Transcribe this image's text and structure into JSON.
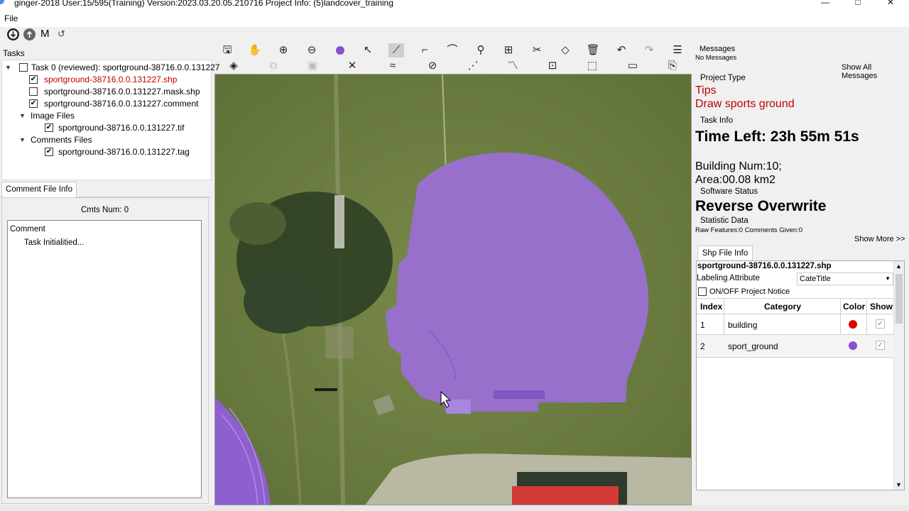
{
  "window": {
    "title": "ginger-2018    User:15/595(Training)    Version:2023.03.20.05.210716    Project Info: (5)landcover_training",
    "minimize": "—",
    "maximize": "□",
    "close": "✕"
  },
  "menu": {
    "file": "File"
  },
  "quick_toolbar": {
    "m_label": "M"
  },
  "tasks": {
    "label": "Tasks",
    "root": "Task 0 (reviewed): sportground-38716.0.0.131227",
    "shp": "sportground-38716.0.0.131227.shp",
    "mask": "sportground-38716.0.0.131227.mask.shp",
    "comment": "sportground-38716.0.0.131227.comment",
    "image_files_label": "Image Files",
    "tif": "sportground-38716.0.0.131227.tif",
    "comments_files_label": "Comments Files",
    "tag": "sportground-38716.0.0.131227.tag"
  },
  "comment_panel": {
    "tab": "Comment File Info",
    "cmts_num": "Cmts Num:  0",
    "comment_header": "Comment",
    "comment_text": "Task Initialitied..."
  },
  "messages": {
    "title": "Messages",
    "body": "No Messages",
    "show_all": "Show All Messages"
  },
  "project_type": {
    "label": "Project Type",
    "tips": "Tips",
    "instruction": "Draw sports ground"
  },
  "task_info": {
    "label": "Task Info",
    "time_left": "Time Left: 23h 55m 51s",
    "building_num": "Building Num:10;",
    "area": "Area:00.08 km2"
  },
  "software_status": {
    "label": "Software Status",
    "value": "Reverse Overwrite"
  },
  "statistic": {
    "label": "Statistic Data",
    "value": "Raw Features:0 Comments Given:0",
    "show_more": "Show More >>"
  },
  "shp_panel": {
    "tab": "Shp File Info",
    "filename": "sportground-38716.0.0.131227.shp",
    "labeling_attribute_label": "Labeling Attribute",
    "labeling_attribute_value": "CateTitle",
    "notice_label": "ON/OFF Project Notice",
    "columns": [
      "Index",
      "Category",
      "Color",
      "Show"
    ],
    "rows": [
      {
        "index": "1",
        "category": "building",
        "color": "#e00000"
      },
      {
        "index": "2",
        "category": "sport_ground",
        "color": "#8a4fd0"
      }
    ]
  },
  "colors": {
    "polygon_fill": "#9b6fd8",
    "accent_purple": "#8a4fd0",
    "tips_red": "#c00000"
  },
  "icons": {
    "toolbar_row1": [
      "save-icon",
      "pan-hand-icon",
      "zoom-in-icon",
      "zoom-out-icon",
      "color-dot-icon",
      "select-arrow-icon",
      "draw-line-icon",
      "edit-vertex-icon",
      "curve-icon",
      "location-pin-icon",
      "split-icon",
      "scissors-icon",
      "eraser-icon",
      "delete-icon",
      "undo-icon",
      "redo-icon",
      "menu-icon"
    ],
    "toolbar_row2": [
      "fill-bucket-icon",
      "copy-disabled-icon",
      "paste-disabled-icon",
      "cut-icon",
      "reshape-icon",
      "rotate-icon",
      "points-line-icon",
      "trend-icon",
      "add-shape-icon",
      "fit-icon",
      "rectangle-icon",
      "export-icon"
    ]
  }
}
